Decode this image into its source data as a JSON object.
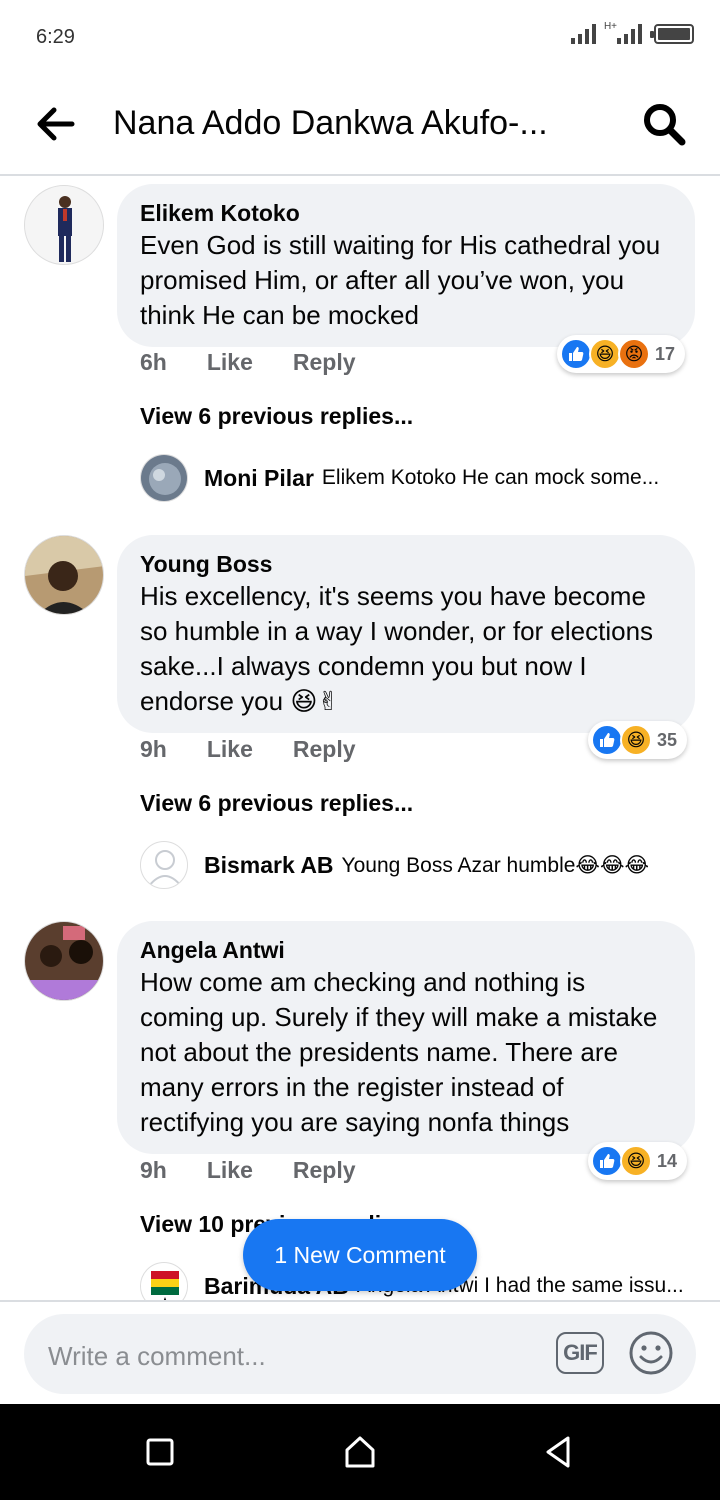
{
  "status": {
    "time": "6:29",
    "network": "H+"
  },
  "header": {
    "title": "Nana Addo Dankwa Akufo-..."
  },
  "comments": [
    {
      "author": "Elikem Kotoko",
      "text": "Even God is still waiting for His cathedral you promised Him, or after all you’ve won, you think He can be mocked",
      "time": "6h",
      "like_label": "Like",
      "reply_label": "Reply",
      "reactions": [
        "like",
        "haha",
        "angry"
      ],
      "reaction_count": "17",
      "view_previous": "View 6 previous replies...",
      "latest_reply": {
        "author": "Moni Pilar",
        "text": "Elikem Kotoko He can mock some..."
      }
    },
    {
      "author": "Young Boss",
      "text": "His excellency, it's seems you have become so humble in a way I wonder, or for elections sake...I always condemn you but now I endorse you 😆✌",
      "time": "9h",
      "like_label": "Like",
      "reply_label": "Reply",
      "reactions": [
        "like",
        "haha"
      ],
      "reaction_count": "35",
      "view_previous": "View 6 previous replies...",
      "latest_reply": {
        "author": "Bismark AB",
        "text": "Young Boss Azar humble😂😂😂"
      }
    },
    {
      "author": "Angela Antwi",
      "text": "How come am checking and nothing is coming up. Surely if they will make a mistake not about the presidents name. There are many errors in the register instead of rectifying you are saying nonfa things",
      "time": "9h",
      "like_label": "Like",
      "reply_label": "Reply",
      "reactions": [
        "like",
        "haha"
      ],
      "reaction_count": "14",
      "view_previous": "View 10 previous replies...",
      "latest_reply": {
        "author": "Barimuda AB",
        "text": "Angela Antwi I had the same issu..."
      }
    }
  ],
  "new_comment_pill": "1 New Comment",
  "composer": {
    "placeholder": "Write a comment...",
    "gif_label": "GIF"
  },
  "colors": {
    "accent": "#1877f2",
    "bubble": "#f0f2f5",
    "muted": "#65676b"
  },
  "icons": [
    "back-arrow-icon",
    "search-icon",
    "gif-icon",
    "emoji-icon",
    "recents-icon",
    "home-icon",
    "back-nav-icon"
  ]
}
